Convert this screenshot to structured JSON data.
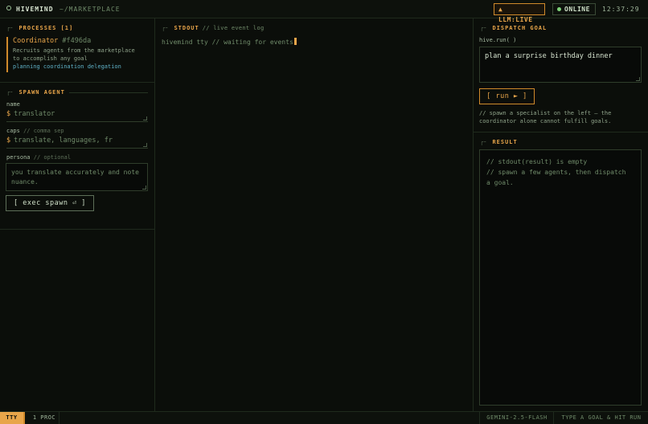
{
  "header": {
    "brand": "HIVEMIND",
    "path": "~/MARKETPLACE",
    "llm_status": "▲ LLM:LIVE",
    "online_label": "ONLINE",
    "clock": "12:37:29"
  },
  "processes": {
    "title": "PROCESSES [1]",
    "items": [
      {
        "name": "Coordinator",
        "hash": "#f496da",
        "description_line1": "Recruits agents from the marketplace",
        "description_line2": "to accomplish any goal",
        "tags": "planning coordination delegation"
      }
    ]
  },
  "spawn": {
    "title": "SPAWN AGENT",
    "name_label": "name",
    "name_prompt": "$",
    "name_value": "translator",
    "caps_label": "caps",
    "caps_sub": "// comma sep",
    "caps_prompt": "$",
    "caps_value": "translate, languages, fr",
    "persona_label": "persona",
    "persona_sub": "// optional",
    "persona_value": "you translate accurately and note nuance.",
    "button": "[ exec spawn ⏎ ]"
  },
  "stdout": {
    "title": "STDOUT",
    "subtitle": "// live event log",
    "line": "hivemind tty // waiting for events"
  },
  "dispatch": {
    "title": "DISPATCH GOAL",
    "call_label": "hive.run( )",
    "goal_value": "plan a surprise birthday dinner",
    "run_button": "[ run ► ]",
    "hint_line1": "// spawn a specialist on the left — the",
    "hint_line2": "coordinator alone cannot fulfill goals."
  },
  "result": {
    "title": "RESULT",
    "line1": "// stdout(result) is empty",
    "line2": "// spawn a few agents, then dispatch",
    "line3": "a goal."
  },
  "statusbar": {
    "tty": "TTY",
    "proc_count": "1 PROC",
    "model": "GEMINI-2.5-FLASH",
    "hint": "TYPE A GOAL & HIT RUN"
  },
  "colors": {
    "accent": "#e8a54a",
    "background": "#0b0e0a",
    "online_dot": "#7fd37a",
    "tag": "#5fb1c7"
  }
}
